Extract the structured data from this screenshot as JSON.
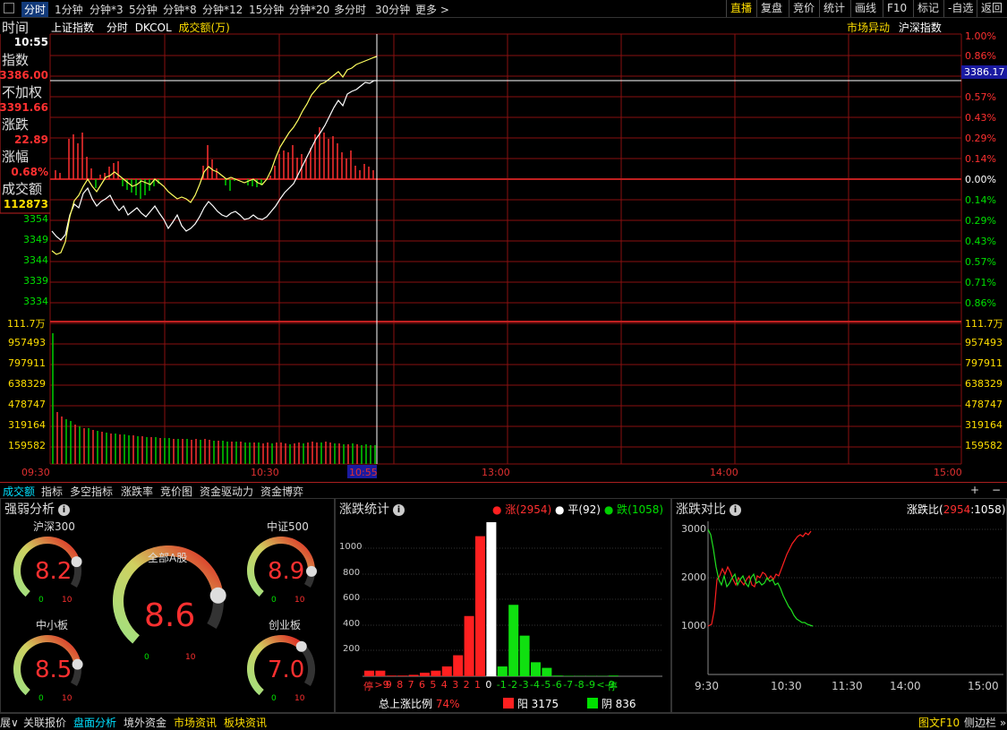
{
  "topbar": {
    "tabs": [
      "分时",
      "1分钟",
      "分钟*3",
      "5分钟",
      "分钟*8",
      "分钟*12",
      "15分钟",
      "分钟*20",
      "多分时",
      "30分钟",
      "更多 >"
    ],
    "right_buttons": [
      "直播",
      "复盘",
      "竞价",
      "统计",
      "画线",
      "F10",
      "标记",
      "-自选",
      "返回"
    ]
  },
  "chart_header": {
    "index_name": "上证指数",
    "mode": "分时",
    "indicator": "DKCOL",
    "volume_label": "成交额(万)",
    "right1": "市场异动",
    "right2": "沪深指数"
  },
  "left_info": {
    "time_label": "时间",
    "time": "10:55",
    "index_label": "指数",
    "index": "3386.00",
    "noadj_label": "不加权",
    "noadj": "3391.66",
    "change_label": "涨跌",
    "change": "22.89",
    "pct_label": "涨幅",
    "pct": "0.68%",
    "amount_label": "成交额",
    "amount": "112873"
  },
  "price_axis": {
    "left_labels": [
      "3354",
      "3349",
      "3344",
      "3339",
      "3334"
    ],
    "right_up": [
      "1.00%",
      "0.86%",
      "0.57%",
      "0.43%",
      "0.29%",
      "0.14%"
    ],
    "right_zero": "0.00%",
    "right_down": [
      "0.14%",
      "0.29%",
      "0.43%",
      "0.57%",
      "0.71%",
      "0.86%"
    ],
    "current_price": "3386.17"
  },
  "volume_axis": {
    "labels": [
      "111.7万",
      "957493",
      "797911",
      "638329",
      "478747",
      "319164",
      "159582"
    ]
  },
  "time_axis": {
    "labels": [
      "09:30",
      "10:30",
      "13:00",
      "14:00",
      "15:00"
    ],
    "cursor": "10:55"
  },
  "bottom_tabs": {
    "tabs": [
      "成交额",
      "指标",
      "多空指标",
      "涨跌率",
      "竞价图",
      "资金驱动力",
      "资金博弈"
    ],
    "plus": "+",
    "minus": "−"
  },
  "strength_panel": {
    "title": "强弱分析",
    "gauges": [
      {
        "name": "沪深300",
        "value": "8.2",
        "min": "0",
        "max": "10",
        "level": 0.82
      },
      {
        "name": "中证500",
        "value": "8.9",
        "min": "0",
        "max": "10",
        "level": 0.89
      },
      {
        "name": "全部A股",
        "value": "8.6",
        "min": "0",
        "max": "10",
        "level": 0.86
      },
      {
        "name": "中小板",
        "value": "8.5",
        "min": "0",
        "max": "10",
        "level": 0.85
      },
      {
        "name": "创业板",
        "value": "7.0",
        "min": "0",
        "max": "10",
        "level": 0.7
      }
    ]
  },
  "updown_panel": {
    "title": "涨跌统计",
    "legend": {
      "up": "涨(2954)",
      "flat": "平(92)",
      "down": "跌(1058)"
    },
    "yticks": [
      "1000",
      "800",
      "600",
      "400",
      "200"
    ],
    "summary_label": "总上涨比例",
    "summary_value": "74%",
    "yang": "阳 3175",
    "yin": "阴 836"
  },
  "compare_panel": {
    "title": "涨跌对比",
    "ratio_label": "涨跌比(",
    "ratio_up": "2954",
    "ratio_sep": ":",
    "ratio_down": "1058",
    "ratio_end": ")",
    "yticks": [
      "3000",
      "2000",
      "1000"
    ],
    "xticks": [
      "9:30",
      "10:30",
      "11:30",
      "14:00",
      "15:00"
    ]
  },
  "status_bar": {
    "items": [
      "展∨",
      "关联报价",
      "盘面分析",
      "境外资金",
      "市场资讯",
      "板块资讯"
    ],
    "right1": "图文F10",
    "right2": "侧边栏 »"
  },
  "chart_data": {
    "type": "bar",
    "categories": [
      "停",
      ">9",
      "9",
      "8",
      "7",
      "6",
      "5",
      "4",
      "3",
      "2",
      "1",
      "0",
      "-1",
      "-2",
      "-3",
      "-4",
      "-5",
      "-6",
      "-7",
      "-8",
      "-9",
      "<-9",
      "停"
    ],
    "values": [
      40,
      40,
      5,
      5,
      10,
      25,
      40,
      70,
      150,
      430,
      1000,
      1100,
      70,
      510,
      290,
      100,
      60,
      5,
      3,
      2,
      2,
      2,
      5
    ],
    "ylim": [
      0,
      1100
    ]
  }
}
